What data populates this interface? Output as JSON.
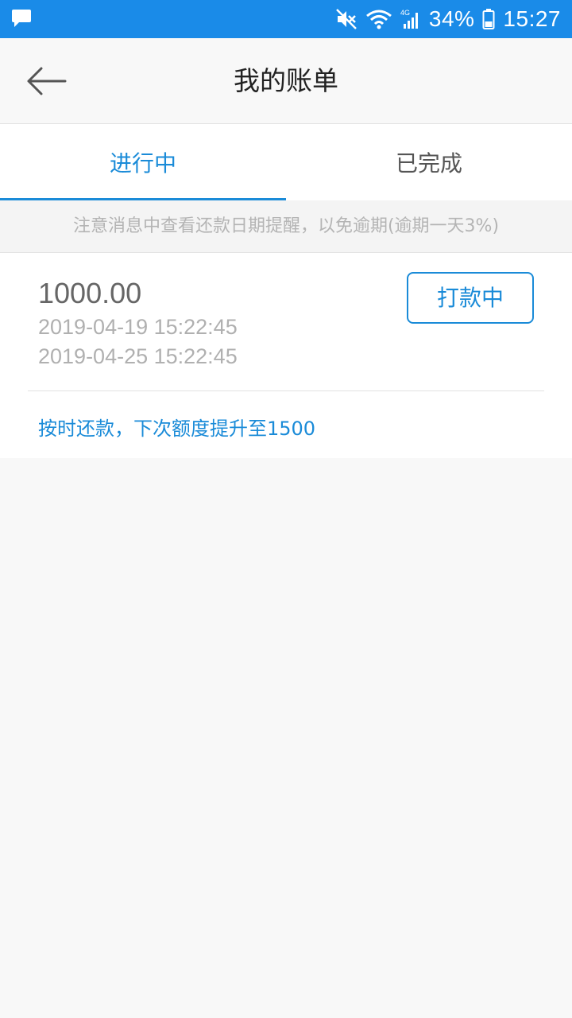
{
  "status_bar": {
    "notification_icon": "chat-bubble-icon",
    "battery_percent": "34%",
    "time": "15:27",
    "icons": [
      "mute-icon",
      "wifi-icon",
      "signal-4g-icon",
      "battery-icon"
    ]
  },
  "header": {
    "back_icon": "arrow-left-icon",
    "title": "我的账单"
  },
  "tabs": [
    {
      "label": "进行中",
      "active": true
    },
    {
      "label": "已完成",
      "active": false
    }
  ],
  "notice": "注意消息中查看还款日期提醒，以免逾期(逾期一天3%)",
  "bill": {
    "amount": "1000.00",
    "start_date": "2019-04-19 15:22:45",
    "due_date": "2019-04-25 15:22:45",
    "status_label": "打款中",
    "tip": "按时还款，下次额度提升至1500"
  },
  "colors": {
    "status_bar": "#1a8be8",
    "accent": "#1a8bd8",
    "background": "#f8f8f8"
  }
}
